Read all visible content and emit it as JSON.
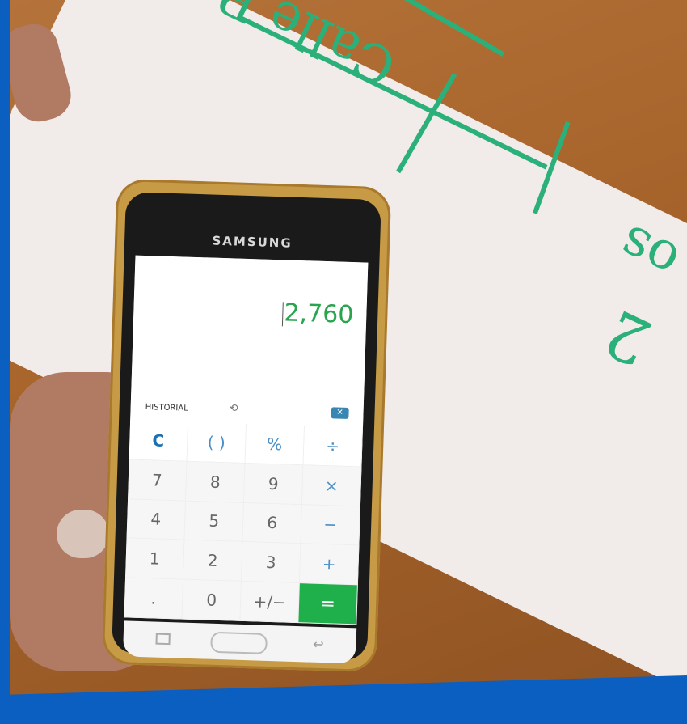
{
  "phone": {
    "brand": "SAMSUNG"
  },
  "calculator": {
    "display_value": "2,760",
    "history_label": "HISTORIAL",
    "keys": [
      {
        "label": "C"
      },
      {
        "label": "( )"
      },
      {
        "label": "%"
      },
      {
        "label": "÷"
      },
      {
        "label": "7"
      },
      {
        "label": "8"
      },
      {
        "label": "9"
      },
      {
        "label": "×"
      },
      {
        "label": "4"
      },
      {
        "label": "5"
      },
      {
        "label": "6"
      },
      {
        "label": "−"
      },
      {
        "label": "1"
      },
      {
        "label": "2"
      },
      {
        "label": "3"
      },
      {
        "label": "+"
      },
      {
        "label": "."
      },
      {
        "label": "0"
      },
      {
        "label": "+/−"
      },
      {
        "label": "="
      }
    ]
  },
  "paper_writing": {
    "line1": "Calle Real",
    "line2": "os",
    "line3": "2"
  },
  "colors": {
    "accent_green": "#1fb04b",
    "frame_blue": "#0b5fc0",
    "marker_green": "#2bb07a"
  }
}
